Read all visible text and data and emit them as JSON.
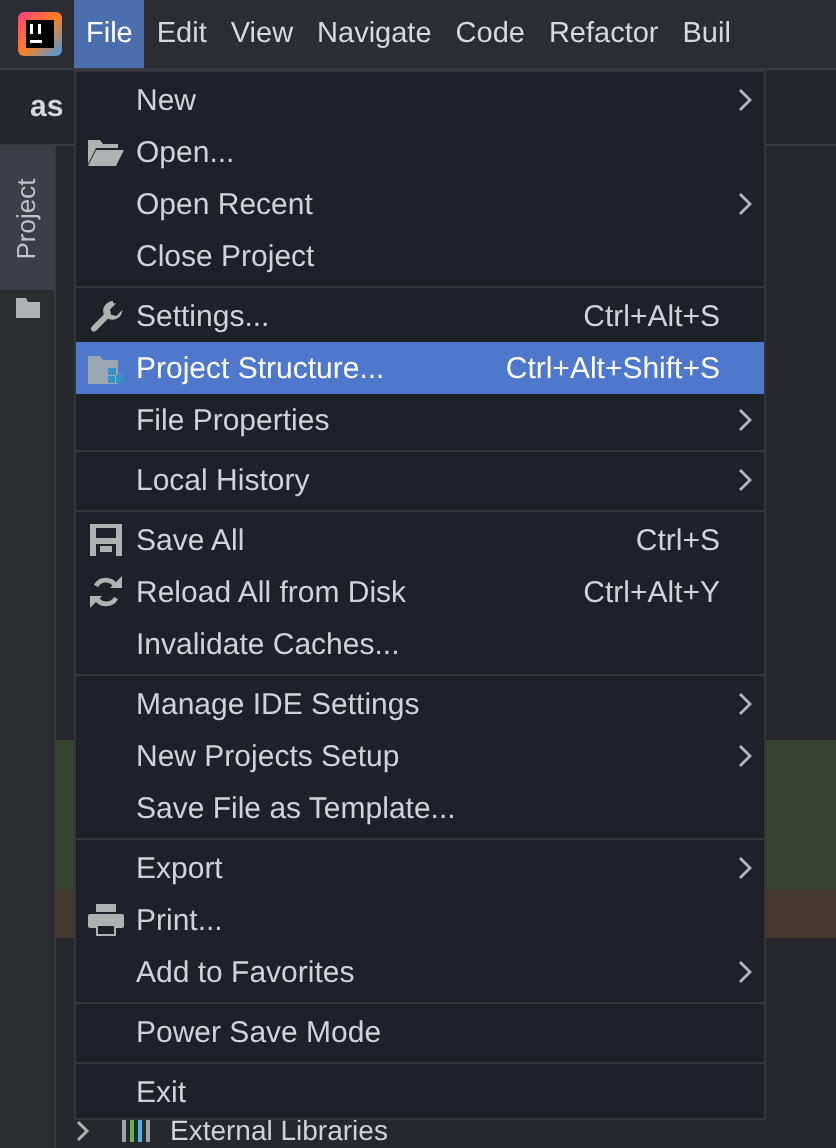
{
  "menubar": {
    "items": [
      {
        "label": "File",
        "selected": true
      },
      {
        "label": "Edit",
        "selected": false
      },
      {
        "label": "View",
        "selected": false
      },
      {
        "label": "Navigate",
        "selected": false
      },
      {
        "label": "Code",
        "selected": false
      },
      {
        "label": "Refactor",
        "selected": false
      },
      {
        "label": "Buil",
        "selected": false
      }
    ]
  },
  "editor_tab": {
    "label": "as"
  },
  "tool_window_tab": {
    "label": "Project"
  },
  "project_tree_row": {
    "label": "External Libraries"
  },
  "file_menu": {
    "items": [
      {
        "kind": "item",
        "label": "New",
        "submenu": true,
        "selected": false
      },
      {
        "kind": "item",
        "label": "Open...",
        "selected": false
      },
      {
        "kind": "item",
        "label": "Open Recent",
        "submenu": true,
        "selected": false
      },
      {
        "kind": "item",
        "label": "Close Project",
        "selected": false
      },
      {
        "kind": "separator"
      },
      {
        "kind": "item",
        "label": "Settings...",
        "shortcut": "Ctrl+Alt+S",
        "selected": false
      },
      {
        "kind": "item",
        "label": "Project Structure...",
        "shortcut": "Ctrl+Alt+Shift+S",
        "selected": true
      },
      {
        "kind": "item",
        "label": "File Properties",
        "submenu": true,
        "selected": false
      },
      {
        "kind": "separator"
      },
      {
        "kind": "item",
        "label": "Local History",
        "submenu": true,
        "selected": false
      },
      {
        "kind": "separator"
      },
      {
        "kind": "item",
        "label": "Save All",
        "shortcut": "Ctrl+S",
        "selected": false
      },
      {
        "kind": "item",
        "label": "Reload All from Disk",
        "shortcut": "Ctrl+Alt+Y",
        "selected": false
      },
      {
        "kind": "item",
        "label": "Invalidate Caches...",
        "selected": false
      },
      {
        "kind": "separator"
      },
      {
        "kind": "item",
        "label": "Manage IDE Settings",
        "submenu": true,
        "selected": false
      },
      {
        "kind": "item",
        "label": "New Projects Setup",
        "submenu": true,
        "selected": false
      },
      {
        "kind": "item",
        "label": "Save File as Template...",
        "selected": false
      },
      {
        "kind": "separator"
      },
      {
        "kind": "item",
        "label": "Export",
        "submenu": true,
        "selected": false
      },
      {
        "kind": "item",
        "label": "Print...",
        "selected": false
      },
      {
        "kind": "item",
        "label": "Add to Favorites",
        "submenu": true,
        "selected": false
      },
      {
        "kind": "separator"
      },
      {
        "kind": "item",
        "label": "Power Save Mode",
        "selected": false
      },
      {
        "kind": "separator"
      },
      {
        "kind": "item",
        "label": "Exit",
        "selected": false
      }
    ]
  }
}
